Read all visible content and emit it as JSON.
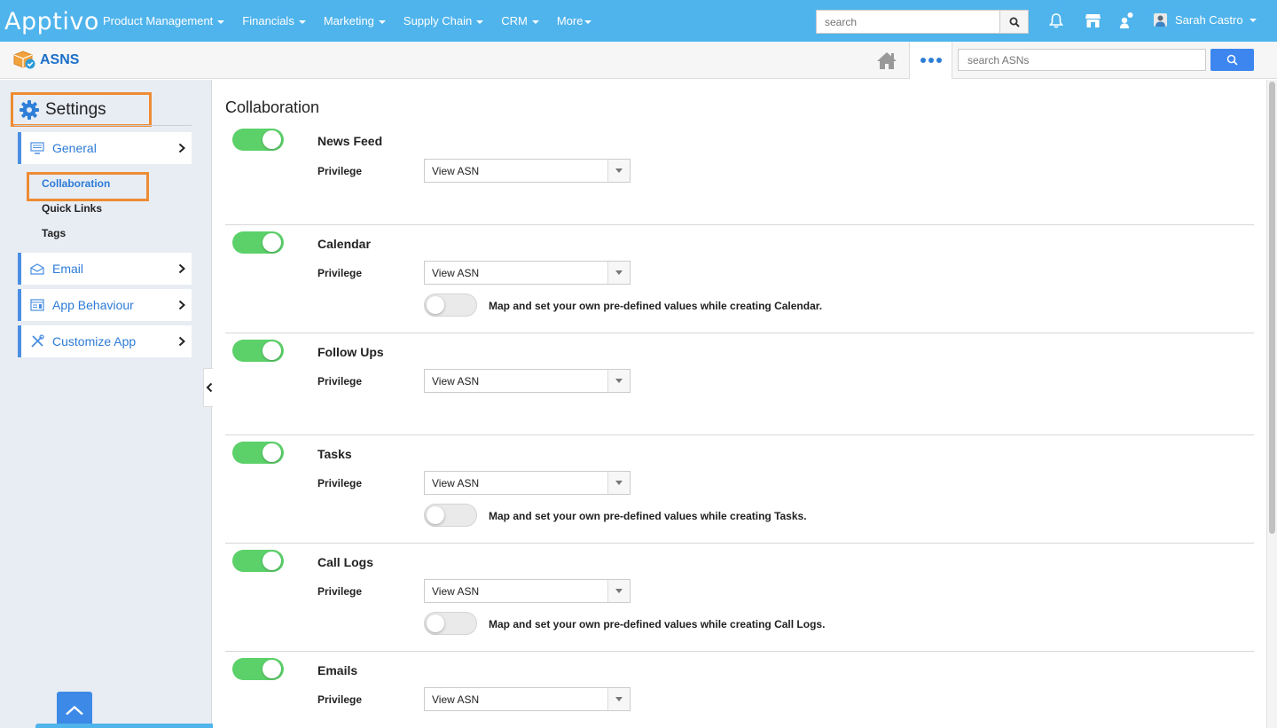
{
  "topnav": {
    "logo": "Apptivo",
    "items": [
      "Product Management",
      "Financials",
      "Marketing",
      "Supply Chain",
      "CRM",
      "More"
    ],
    "search_placeholder": "search",
    "user_name": "Sarah Castro"
  },
  "app": {
    "title": "ASNS",
    "search_placeholder": "search ASNs"
  },
  "sidebar": {
    "settings_label": "Settings",
    "general": "General",
    "sublinks": [
      "Collaboration",
      "Quick Links",
      "Tags"
    ],
    "email": "Email",
    "app_behaviour": "App Behaviour",
    "customize_app": "Customize App"
  },
  "main": {
    "title": "Collaboration",
    "privilege_label": "Privilege",
    "sections": [
      {
        "name": "News Feed",
        "enabled": true,
        "privilege": "View ASN",
        "map_text": ""
      },
      {
        "name": "Calendar",
        "enabled": true,
        "privilege": "View ASN",
        "map_text": "Map and set your own pre-defined values while creating Calendar."
      },
      {
        "name": "Follow Ups",
        "enabled": true,
        "privilege": "View ASN",
        "map_text": ""
      },
      {
        "name": "Tasks",
        "enabled": true,
        "privilege": "View ASN",
        "map_text": "Map and set your own pre-defined values while creating Tasks."
      },
      {
        "name": "Call Logs",
        "enabled": true,
        "privilege": "View ASN",
        "map_text": "Map and set your own pre-defined values while creating Call Logs."
      },
      {
        "name": "Emails",
        "enabled": true,
        "privilege": "View ASN",
        "map_text": ""
      }
    ]
  },
  "colors": {
    "topbar": "#4fb3ec",
    "accent": "#2d7bd6",
    "toggle_on": "#5cd069",
    "highlight": "#ed8c32"
  },
  "icons": [
    "search-icon",
    "bell-icon",
    "store-icon",
    "users-icon",
    "home-icon",
    "gear-icon",
    "monitor-icon",
    "envelope-icon",
    "app-behaviour-icon",
    "tools-icon",
    "chevron-right-icon",
    "chevron-left-icon",
    "chevron-up-icon"
  ]
}
